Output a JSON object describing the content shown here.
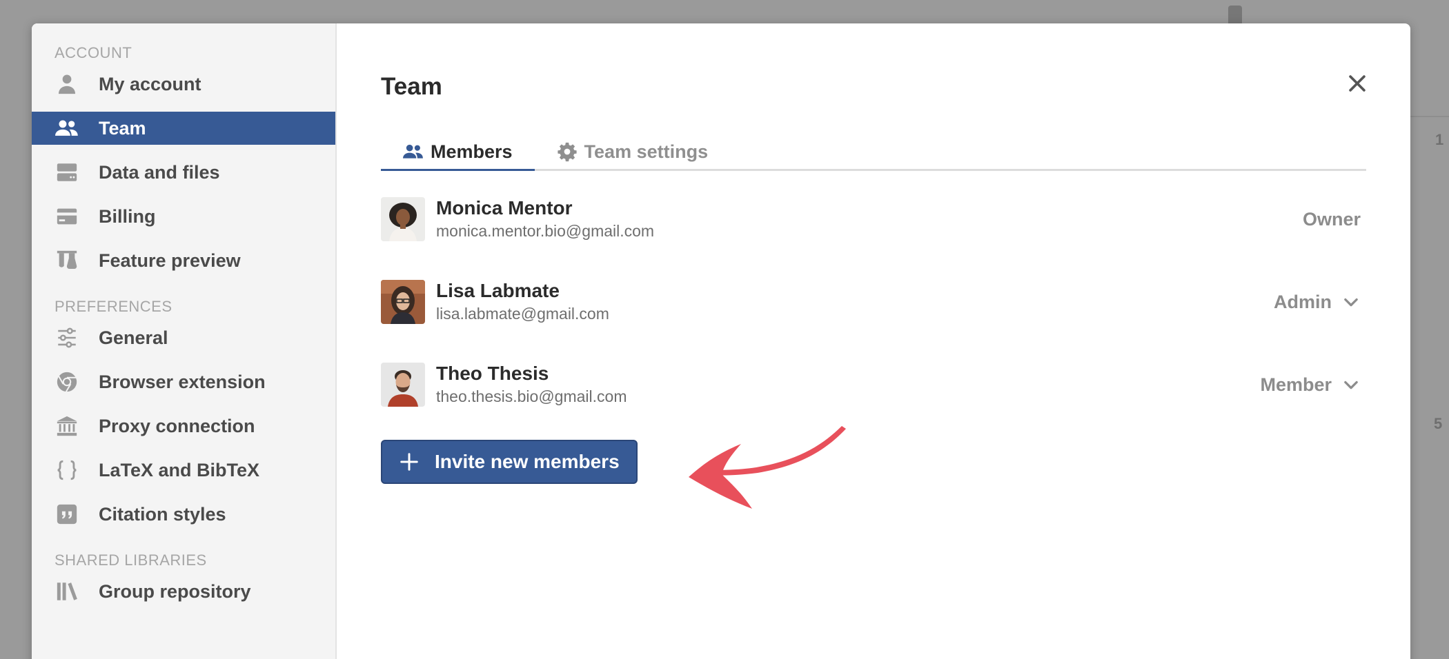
{
  "sidebar": {
    "sections": [
      {
        "heading": "ACCOUNT",
        "items": [
          {
            "label": "My account",
            "icon": "user-icon"
          },
          {
            "label": "Team",
            "icon": "users-icon",
            "active": true
          },
          {
            "label": "Data and files",
            "icon": "storage-icon"
          },
          {
            "label": "Billing",
            "icon": "credit-card-icon"
          },
          {
            "label": "Feature preview",
            "icon": "flask-icon"
          }
        ]
      },
      {
        "heading": "PREFERENCES",
        "items": [
          {
            "label": "General",
            "icon": "sliders-icon"
          },
          {
            "label": "Browser extension",
            "icon": "chrome-icon"
          },
          {
            "label": "Proxy connection",
            "icon": "institution-icon"
          },
          {
            "label": "LaTeX and BibTeX",
            "icon": "braces-icon"
          },
          {
            "label": "Citation styles",
            "icon": "quote-icon"
          }
        ]
      },
      {
        "heading": "SHARED LIBRARIES",
        "items": [
          {
            "label": "Group repository",
            "icon": "library-icon"
          }
        ]
      }
    ]
  },
  "main": {
    "title": "Team",
    "tabs": [
      {
        "label": "Members",
        "icon": "users-icon",
        "active": true
      },
      {
        "label": "Team settings",
        "icon": "gear-icon",
        "active": false
      }
    ],
    "members": [
      {
        "name": "Monica Mentor",
        "email": "monica.mentor.bio@gmail.com",
        "role": "Owner",
        "editable": false
      },
      {
        "name": "Lisa Labmate",
        "email": "lisa.labmate@gmail.com",
        "role": "Admin",
        "editable": true
      },
      {
        "name": "Theo Thesis",
        "email": "theo.thesis.bio@gmail.com",
        "role": "Member",
        "editable": true
      }
    ],
    "invite_label": "Invite new members"
  },
  "colors": {
    "accent": "#375a95",
    "annotation_arrow": "#e8505b",
    "sidebar_bg": "#f4f4f4",
    "overlay": "#9a9a9a"
  }
}
